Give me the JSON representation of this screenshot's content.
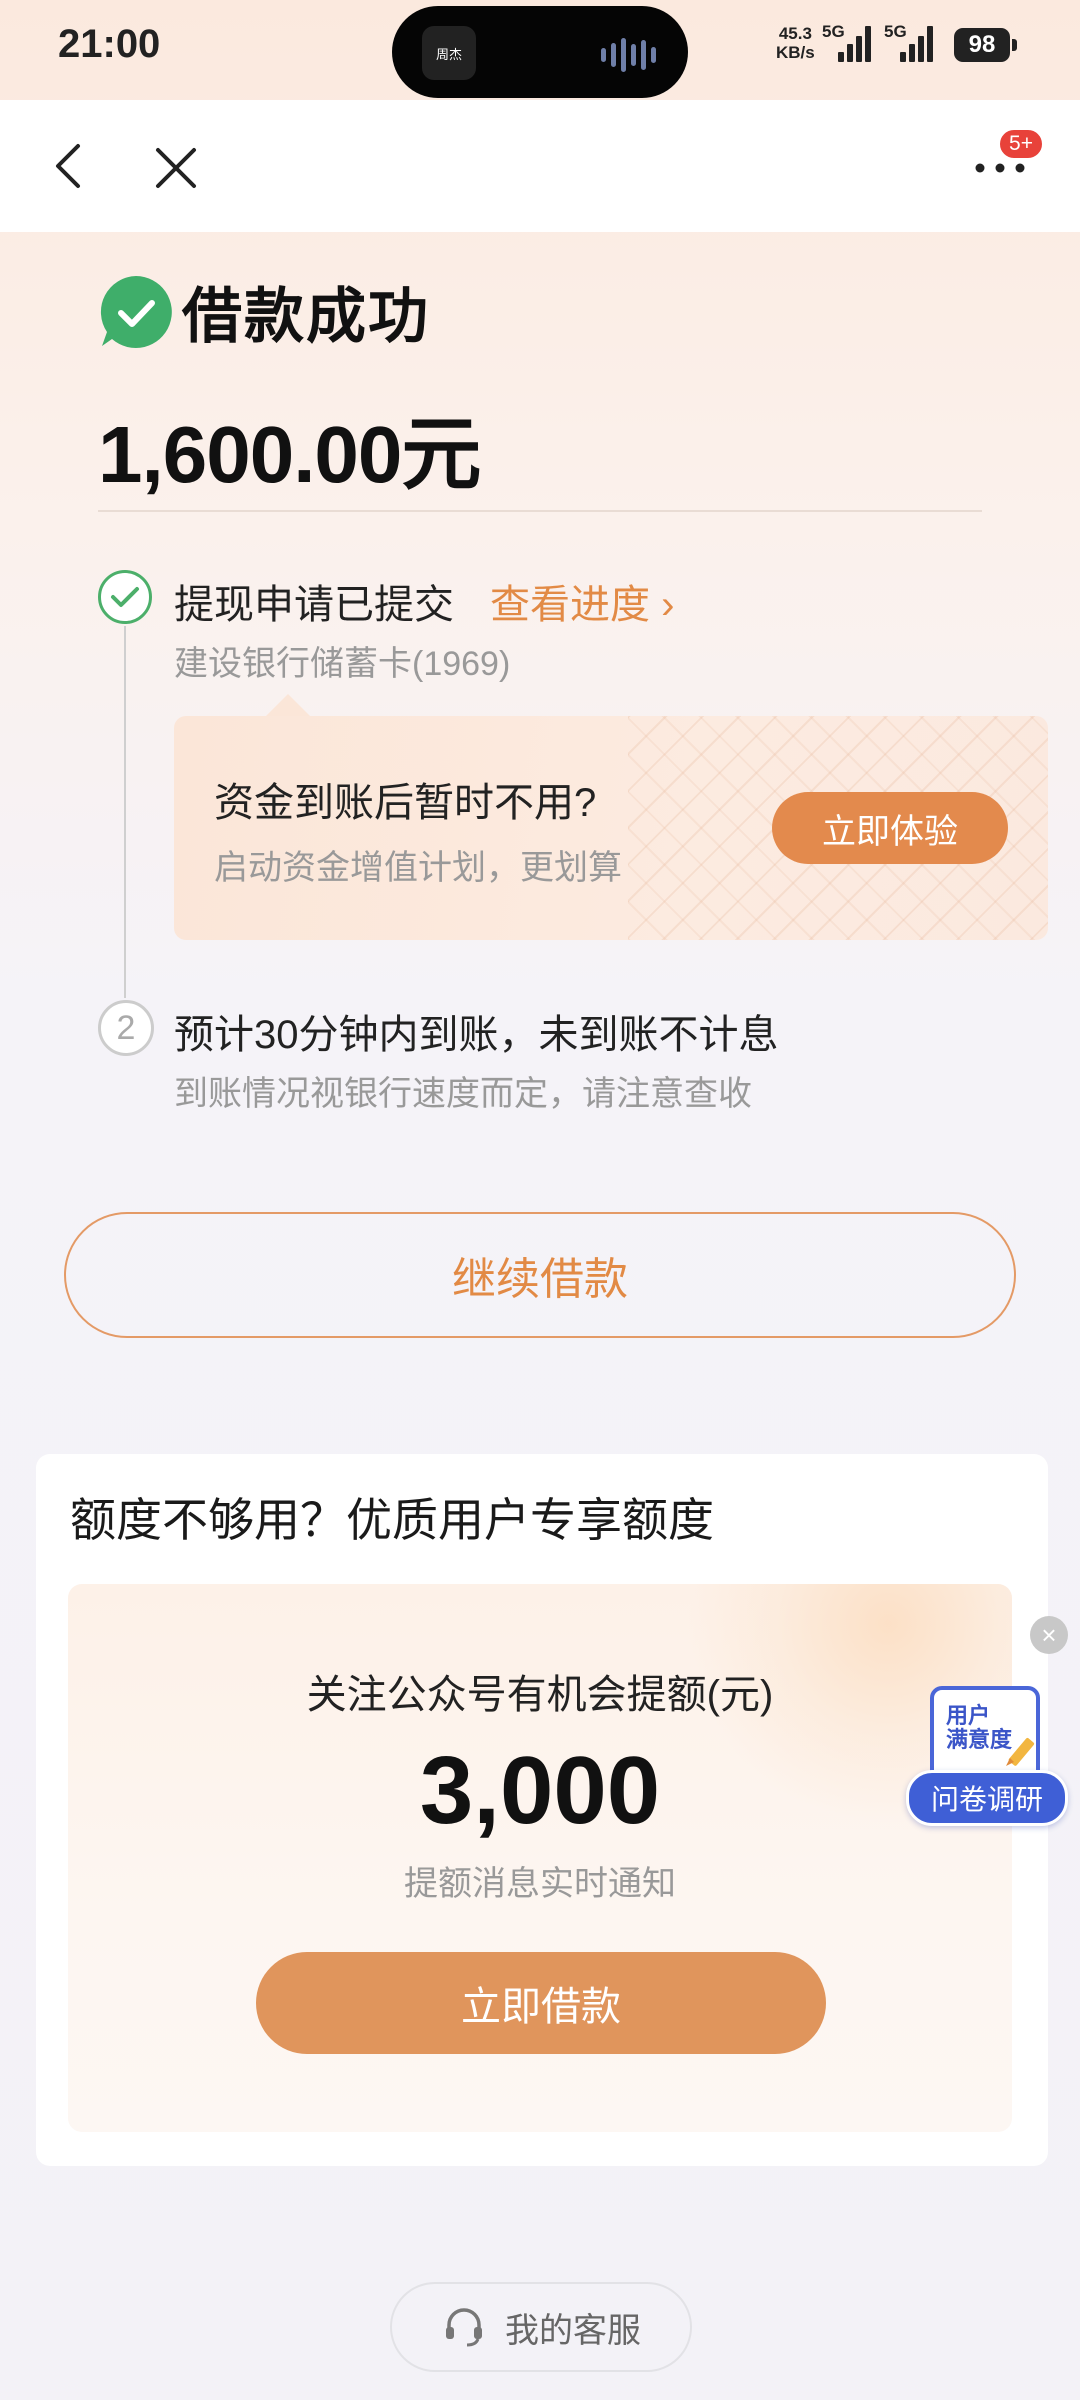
{
  "status_bar": {
    "time": "21:00",
    "island_app": "周杰",
    "net_speed_value": "45.3",
    "net_speed_unit": "KB/s",
    "signal1_label": "5G",
    "signal2_label": "5G",
    "battery": "98"
  },
  "nav": {
    "badge": "5+"
  },
  "result": {
    "title": "借款成功",
    "amount": "1,600.00元"
  },
  "steps": [
    {
      "title": "提现申请已提交",
      "link": "查看进度 ›",
      "subtitle": "建设银行储蓄卡(1969)"
    },
    {
      "number": "2",
      "title": "预计30分钟内到账，未到账不计息",
      "subtitle": "到账情况视银行速度而定，请注意查收"
    }
  ],
  "promo": {
    "title": "资金到账后暂时不用?",
    "subtitle": "启动资金增值计划，更划算",
    "button": "立即体验"
  },
  "continue_button": "继续借款",
  "quota": {
    "title": "额度不够用？优质用户专享额度",
    "label": "关注公众号有机会提额(元)",
    "value": "3,000",
    "note": "提额消息实时通知",
    "button": "立即借款"
  },
  "survey": {
    "card_line1": "用户",
    "card_line2": "满意度",
    "pill": "问卷调研",
    "close": "×"
  },
  "service": {
    "label": "我的客服"
  },
  "colors": {
    "accent": "#e28a45",
    "success": "#4caf6a",
    "survey_blue": "#3f5fd6"
  }
}
